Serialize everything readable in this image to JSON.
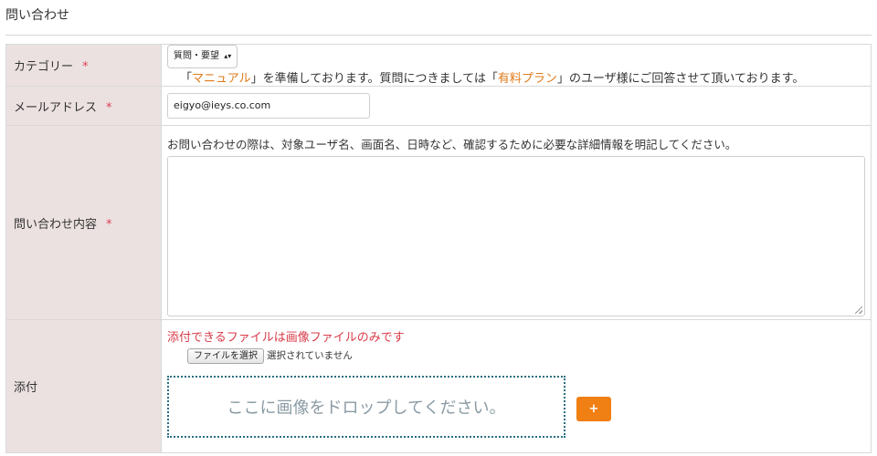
{
  "page": {
    "title": "問い合わせ"
  },
  "form": {
    "required_mark": "*",
    "category": {
      "label": "カテゴリー",
      "selected": "質問・要望",
      "note_prefix": "「",
      "manual_link": "マニュアル",
      "note_mid": "」を準備しております。質問につきましては「",
      "paid_plan_link": "有料プラン",
      "note_suffix": "」のユーザ様にご回答させて頂いております。"
    },
    "email": {
      "label": "メールアドレス",
      "value": "eigyo@ieys.co.com"
    },
    "inquiry": {
      "label": "問い合わせ内容",
      "hint": "お問い合わせの際は、対象ユーザ名、画面名、日時など、確認するために必要な詳細情報を明記してください。",
      "value": ""
    },
    "attachment": {
      "label": "添付",
      "warning": "添付できるファイルは画像ファイルのみです",
      "choose_button": "ファイルを選択",
      "file_status": "選択されていません",
      "drop_text": "ここに画像をドロップしてください。",
      "add_button": "+"
    }
  },
  "colors": {
    "label_bg": "#ece1e1",
    "accent_orange": "#f07f14",
    "link_orange": "#e07b1a",
    "required_red": "#d94055",
    "warning_red": "#d93a48",
    "drop_border": "#2b6e82"
  }
}
